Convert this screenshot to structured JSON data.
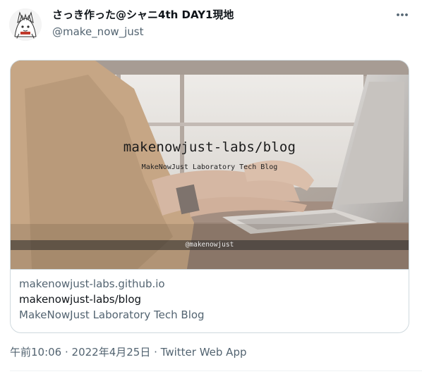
{
  "author": {
    "display_name": "さっき作った@シャニ4th DAY1現地",
    "handle": "@make_now_just",
    "avatar_icon": "avatar-illustration-icon"
  },
  "menu": {
    "more_icon": "more-horizontal-icon"
  },
  "card": {
    "image": {
      "title": "makenowjust-labs/blog",
      "subtitle": "MakeNowJust Laboratory Tech Blog",
      "credit": "@makenowjust"
    },
    "domain": "makenowjust-labs.github.io",
    "title": "makenowjust-labs/blog",
    "description": "MakeNowJust Laboratory Tech Blog"
  },
  "meta": {
    "time": "午前10:06",
    "separator": " · ",
    "date": "2022年4月25日",
    "source": "Twitter Web App"
  },
  "colors": {
    "text_primary": "#0f1419",
    "text_secondary": "#536471",
    "border": "#cfd9de"
  }
}
